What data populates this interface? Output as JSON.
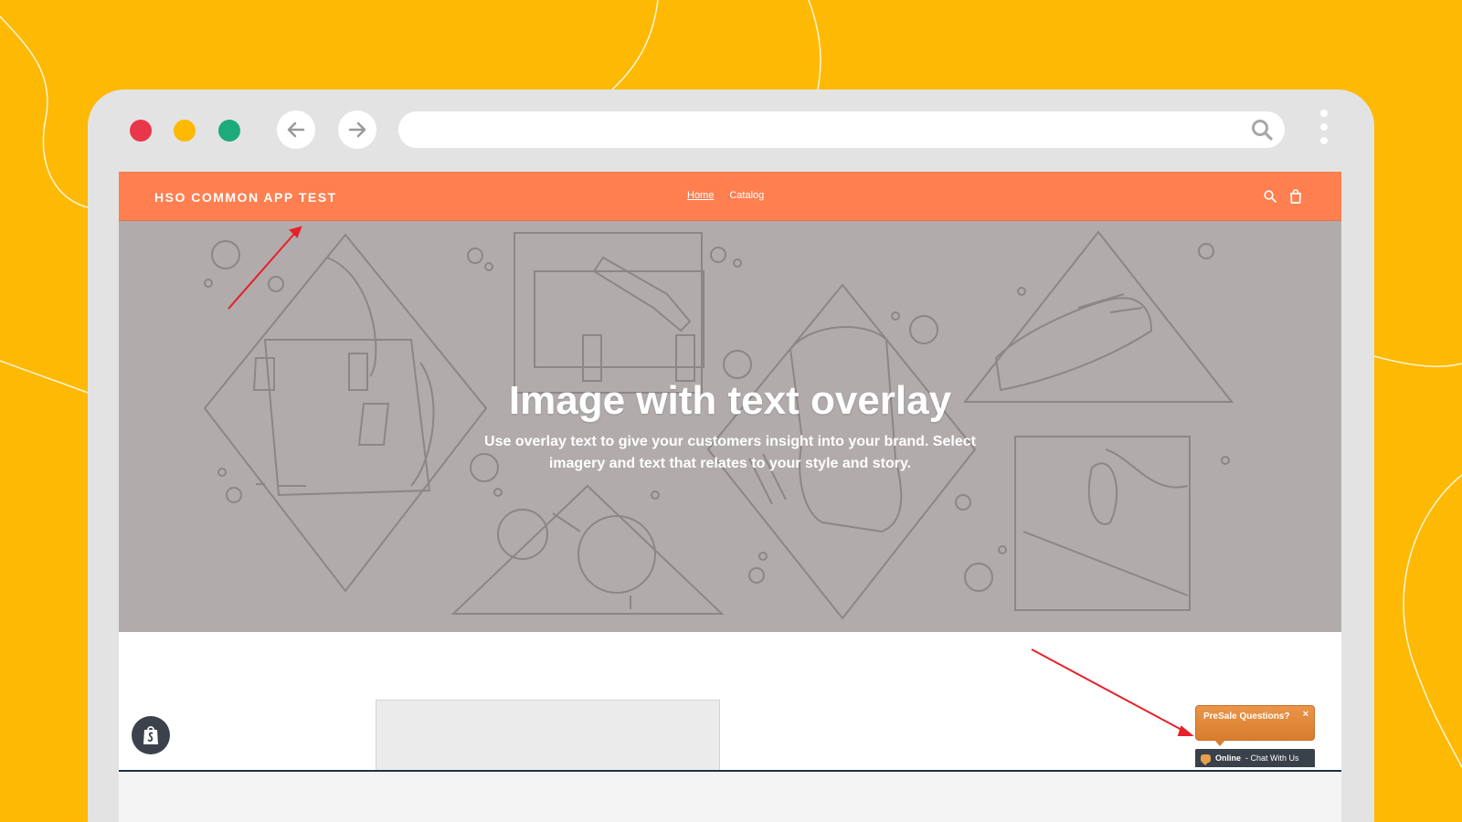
{
  "colors": {
    "background": "#FDB904",
    "browser_frame": "#E3E3E3",
    "header": "#FF7F50",
    "hero": "#B1ABAB",
    "annotation_arrow": "#E8202A"
  },
  "browser": {
    "traffic_lights": [
      "red",
      "yellow",
      "green"
    ],
    "url_value": "",
    "url_placeholder": "",
    "icons": {
      "back": "arrow-left-icon",
      "forward": "arrow-right-icon",
      "search": "search-icon",
      "menu": "kebab-menu-icon"
    }
  },
  "site": {
    "logo": "HSO COMMON APP TEST",
    "nav": [
      {
        "label": "Home",
        "active": true
      },
      {
        "label": "Catalog",
        "active": false
      }
    ],
    "header_icons": [
      "search-icon",
      "cart-icon"
    ]
  },
  "hero": {
    "title": "Image with text overlay",
    "subtitle": "Use overlay text to give your customers insight into your brand. Select imagery and text that relates to your style and story."
  },
  "chat_widget": {
    "bubble_text": "PreSale Questions?",
    "close_label": "×",
    "status": "Online",
    "action": " - Chat With Us"
  }
}
